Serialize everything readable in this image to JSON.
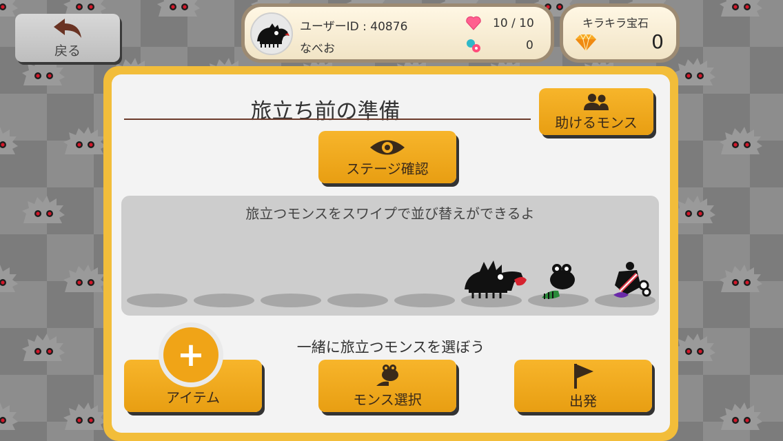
{
  "header": {
    "back_label": "戻る",
    "user_id_label": "ユーザーID : 40876",
    "user_name": "なべお",
    "hearts": "10 / 10",
    "candy": "0"
  },
  "gems": {
    "label": "キラキラ宝石",
    "count": "0"
  },
  "main": {
    "title": "旅立ち前の準備",
    "helper_label": "助けるモンス",
    "stage_label": "ステージ確認",
    "swipe_hint": "旅立つモンスをスワイプで並び替えができるよ",
    "choose_text": "一緒に旅立つモンスを選ぼう",
    "item_label": "アイテム",
    "mons_select_label": "モンス選択",
    "depart_label": "出発"
  },
  "colors": {
    "accent": "#f0a417",
    "frame": "#f2bd3a",
    "bg_dark": "#7c7c7c",
    "bg_light": "#8d8d8d"
  },
  "icons": [
    "back-arrow-icon",
    "avatar-monster-icon",
    "heart-icon",
    "candy-icon",
    "diamond-icon",
    "people-icon",
    "eye-icon",
    "plus-icon",
    "monster-icon",
    "flag-icon"
  ]
}
